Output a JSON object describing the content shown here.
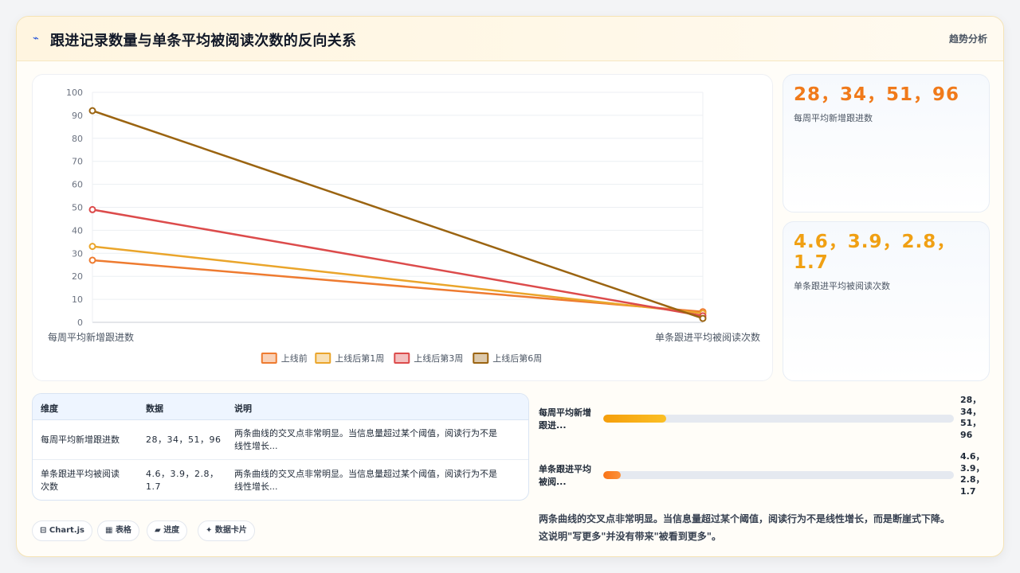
{
  "header": {
    "icon": "trend-icon",
    "title": "跟进记录数量与单条平均被阅读次数的反向关系",
    "right_label": "趋势分析"
  },
  "chart_data": {
    "type": "line",
    "categories": [
      "每周平均新增跟进数",
      "单条跟进平均被阅读次数"
    ],
    "series": [
      {
        "name": "上线前",
        "values": [
          27,
          4.6
        ],
        "color": "#ee7b30"
      },
      {
        "name": "上线后第1周",
        "values": [
          33,
          3.9
        ],
        "color": "#eaa52b"
      },
      {
        "name": "上线后第3周",
        "values": [
          49,
          2.8
        ],
        "color": "#dc4b4b"
      },
      {
        "name": "上线后第6周",
        "values": [
          92,
          1.7
        ],
        "color": "#9b6411"
      }
    ],
    "ylim": [
      0,
      100
    ],
    "yticks": [
      "0",
      "10",
      "20",
      "30",
      "40",
      "50",
      "60",
      "70",
      "80",
      "90",
      "100"
    ],
    "grid": true,
    "legend_position": "bottom"
  },
  "stats": [
    {
      "value": "28，34，51，96",
      "label": "每周平均新增跟进数",
      "color": "#f07a1a"
    },
    {
      "value": "4.6，3.9，2.8，1.7",
      "label": "单条跟进平均被阅读次数",
      "color": "#f0a013"
    }
  ],
  "table": {
    "headers": [
      "维度",
      "数据",
      "说明"
    ],
    "rows": [
      {
        "dim": "每周平均新增跟进数",
        "data": "28，34，51，96",
        "desc_line1": "两条曲线的交叉点非常明显。当信息量超过某个阈值，阅读行为不是",
        "desc_line2": "线性增长..."
      },
      {
        "dim_line1": "单条跟进平均被阅读",
        "dim_line2": "次数",
        "data_line1": "4.6，3.9，2.8，",
        "data_line2": "1.7",
        "desc_line1": "两条曲线的交叉点非常明显。当信息量超过某个阈值，阅读行为不是",
        "desc_line2": "线性增长..."
      }
    ]
  },
  "bars": [
    {
      "label_line1": "每周平均新增",
      "label_line2": "跟进...",
      "fill": 0.18,
      "value_lines": [
        "28，",
        "34，",
        "51，",
        "96"
      ]
    },
    {
      "label_line1": "单条跟进平均",
      "label_line2": "被阅...",
      "fill": 0.05,
      "value_lines": [
        "4.6，",
        "3.9，",
        "2.8，",
        "1.7"
      ]
    }
  ],
  "summary": {
    "line1": "两条曲线的交叉点非常明显。当信息量超过某个阈值，阅读行为不是线性增长，而是断崖式下降。",
    "line2": "这说明\"写更多\"并没有带来\"被看到更多\"。"
  },
  "tags": [
    {
      "icon": "code-icon",
      "glyph": "⊟",
      "label": "Chart.js"
    },
    {
      "icon": "table-icon",
      "glyph": "▦",
      "label": "表格"
    },
    {
      "icon": "progress-icon",
      "glyph": "▰",
      "label": "进度"
    },
    {
      "icon": "card-icon",
      "glyph": "✦",
      "label": "数据卡片"
    }
  ]
}
